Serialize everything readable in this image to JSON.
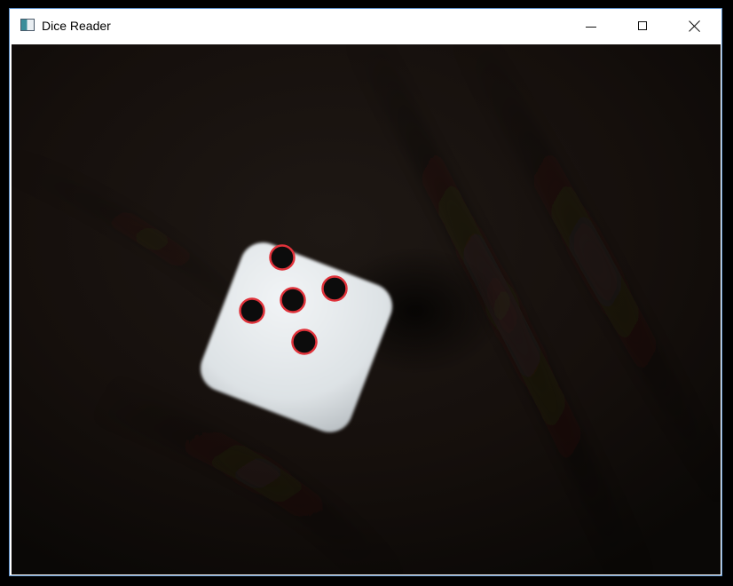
{
  "window": {
    "title": "Dice Reader",
    "icon": "app-window-icon",
    "controls": {
      "minimize_icon": "minimize-icon",
      "maximize_icon": "maximize-icon",
      "close_icon": "close-icon"
    }
  },
  "camera_view": {
    "background_color": "#120e0c",
    "die": {
      "face_color": "#e3e7ea",
      "detected_pips": 5,
      "pip_color": "#0c0c0c",
      "detection_outline_color": "#e0323a"
    }
  }
}
